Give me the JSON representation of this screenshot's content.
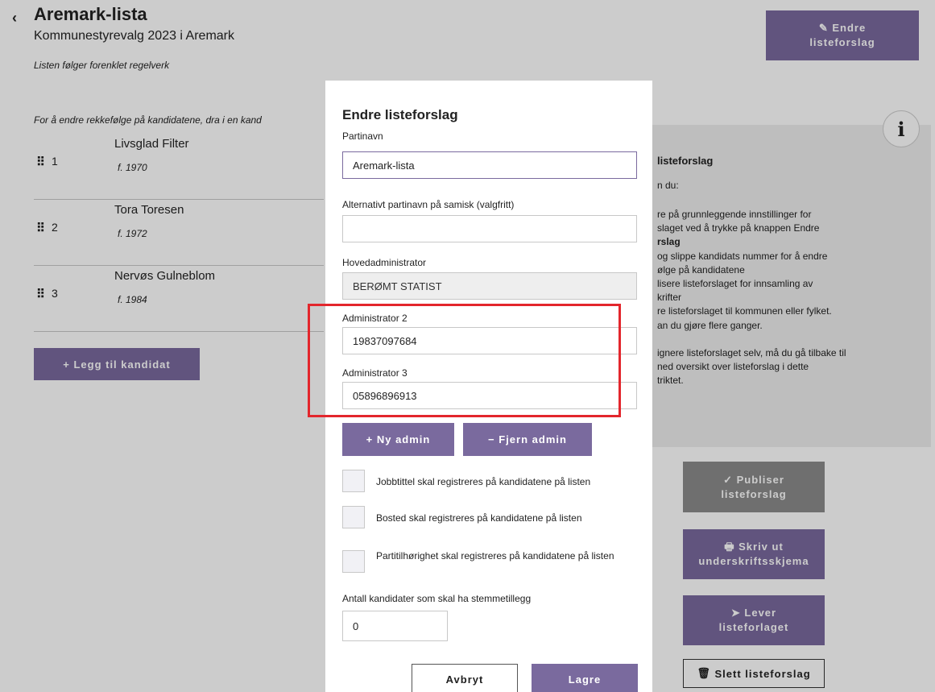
{
  "header": {
    "back": "‹",
    "title": "Aremark-lista",
    "subtitle": "Kommunestyrevalg 2023 i Aremark",
    "rules_note": "Listen følger forenklet regelverk",
    "reorder_note": "For å endre rekkefølge på kandidatene, dra i en kand"
  },
  "candidates": [
    {
      "number": "1",
      "name": "Livsglad Filter",
      "born": "f. 1970"
    },
    {
      "number": "2",
      "name": "Tora Toresen",
      "born": "f. 1972"
    },
    {
      "number": "3",
      "name": "Nervøs Gulneblom",
      "born": "f. 1984"
    }
  ],
  "add_candidate": "+ Legg til kandidat",
  "edit_button": {
    "icon": "✎",
    "line1": "Endre",
    "line2": "listeforslag"
  },
  "info": {
    "icon": "i",
    "title": "listeforslag",
    "intro": "n du:",
    "lines": [
      "re på grunnleggende innstillinger for",
      "slaget ved å trykke på knappen Endre",
      "rslag",
      "og slippe kandidats nummer for å endre",
      "ølge på kandidatene",
      "lisere listeforslaget for innsamling av",
      "krifter",
      "re listeforslaget til kommunen eller fylket.",
      "an du gjøre flere ganger.",
      "",
      "ignere listeforslaget selv, må du gå tilbake til",
      "ned oversikt over listeforslag i dette",
      "triktet."
    ]
  },
  "side_buttons": {
    "publish": {
      "icon": "✓",
      "line1": "Publiser",
      "line2": "listeforslag"
    },
    "print": {
      "icon": "🖶",
      "line1": "Skriv ut",
      "line2": "underskriftsskjema"
    },
    "deliver": {
      "icon": "➤",
      "line1": "Lever",
      "line2": "listeforlaget"
    },
    "delete": {
      "icon": "🗑",
      "label": "Slett listeforslag"
    }
  },
  "modal": {
    "title": "Endre listeforslag",
    "party_name_label": "Partinavn",
    "party_name_value": "Aremark-lista",
    "sami_label": "Alternativt partinavn på samisk (valgfritt)",
    "sami_value": "",
    "main_admin_label": "Hovedadministrator",
    "main_admin_value": "BERØMT STATIST",
    "admin2_label": "Administrator 2",
    "admin2_value": "19837097684",
    "admin3_label": "Administrator 3",
    "admin3_value": "05896896913",
    "new_admin": "+ Ny admin",
    "remove_admin": "− Fjern admin",
    "checkboxes": [
      {
        "label": "Jobbtittel skal registreres på kandidatene på listen",
        "checked": false
      },
      {
        "label": "Bosted skal registreres på kandidatene på listen",
        "checked": false
      },
      {
        "label": "Partitilhørighet skal registreres på kandidatene på listen",
        "checked": false
      }
    ],
    "vote_bonus_label": "Antall kandidater som skal ha stemmetillegg",
    "vote_bonus_value": "0",
    "cancel": "Avbryt",
    "save": "Lagre"
  },
  "colors": {
    "accent": "#7a6a9e",
    "highlight": "#e3262c",
    "disabled_button": "#8b8b8b"
  }
}
